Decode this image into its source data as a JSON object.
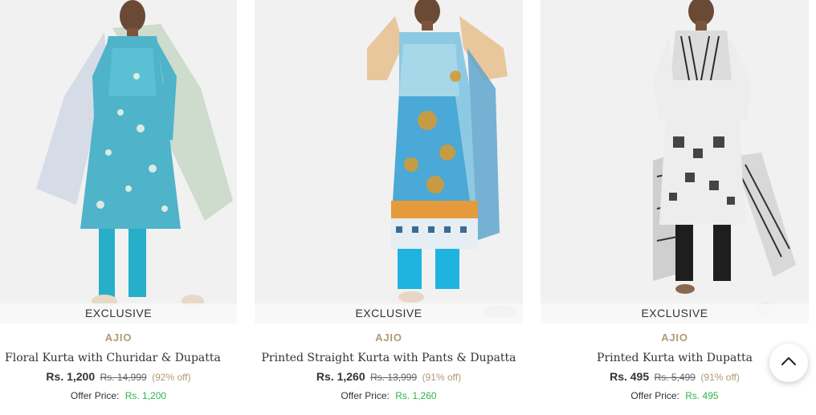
{
  "products": [
    {
      "badge": "EXCLUSIVE",
      "brand": "AJIO",
      "name": "Floral Kurta with Churidar & Dupatta",
      "price": "Rs. 1,200",
      "original_price": "Rs. 14,999",
      "discount": "(92% off)",
      "offer_label": "Offer Price:",
      "offer_price": "Rs. 1,200"
    },
    {
      "badge": "EXCLUSIVE",
      "brand": "AJIO",
      "name": "Printed Straight Kurta with Pants & Dupatta",
      "price": "Rs. 1,260",
      "original_price": "Rs. 13,999",
      "discount": "(91% off)",
      "offer_label": "Offer Price:",
      "offer_price": "Rs. 1,260"
    },
    {
      "badge": "EXCLUSIVE",
      "brand": "AJIO",
      "name": "Printed Kurta with Dupatta",
      "price": "Rs. 495",
      "original_price": "Rs. 5,499",
      "discount": "(91% off)",
      "offer_label": "Offer Price:",
      "offer_price": "Rs. 495"
    }
  ],
  "scroll_top": {
    "icon": "chevron-up-icon"
  },
  "colors": {
    "brand": "#b19975",
    "offer_price": "#2db54a",
    "image_background": "#f1f1f1"
  }
}
